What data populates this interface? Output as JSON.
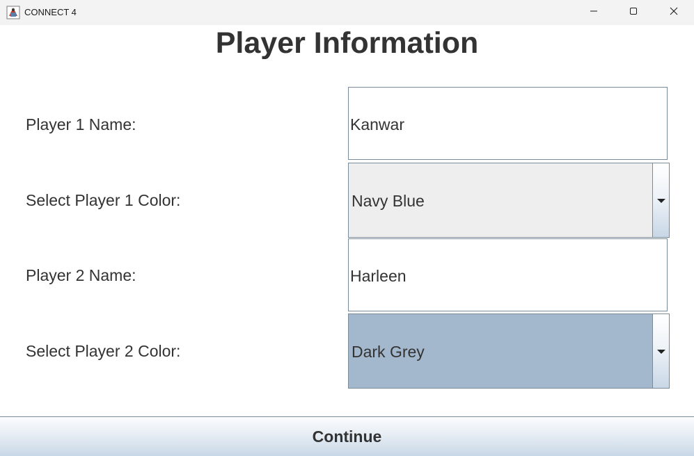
{
  "window": {
    "title": "CONNECT 4",
    "controls": {
      "minimize_icon": "minimize-icon",
      "maximize_icon": "maximize-icon",
      "close_icon": "close-icon"
    }
  },
  "form": {
    "heading": "Player Information",
    "player1": {
      "name_label": "Player 1 Name:",
      "name_value": "Kanwar",
      "color_label": "Select Player 1 Color:",
      "color_value": "Navy Blue"
    },
    "player2": {
      "name_label": "Player 2 Name:",
      "name_value": "Harleen",
      "color_label": "Select Player 2 Color:",
      "color_value": "Dark Grey"
    },
    "continue_label": "Continue"
  },
  "colors": {
    "combo1_bg": "#eeeeee",
    "combo2_bg": "#a3b8cc",
    "text": "#333333",
    "border": "#7a8a99"
  }
}
